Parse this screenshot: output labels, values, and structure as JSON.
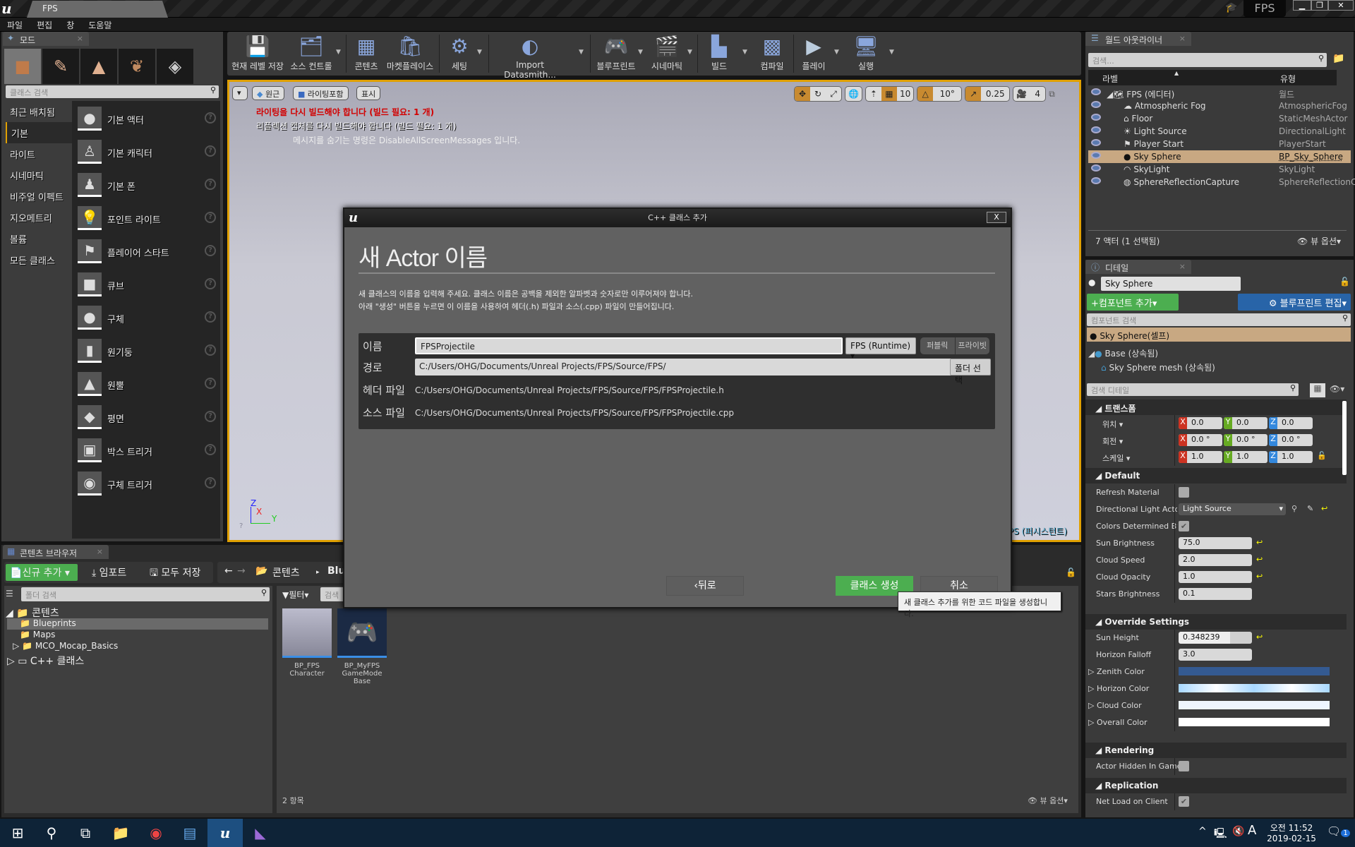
{
  "window": {
    "doc_tab": "FPS",
    "project_label": "FPS",
    "controls": {
      "minimize": "▁",
      "restore": "❐",
      "close": "✕"
    }
  },
  "menu": [
    "파일",
    "편집",
    "창",
    "도움말"
  ],
  "modes_panel": {
    "tab_label": "모드",
    "search_placeholder": "클래스 검색",
    "categories": [
      {
        "label": "최근 배치됨",
        "selected": false
      },
      {
        "label": "기본",
        "selected": true
      },
      {
        "label": "라이트",
        "selected": false
      },
      {
        "label": "시네마틱",
        "selected": false
      },
      {
        "label": "비주얼 이펙트",
        "selected": false
      },
      {
        "label": "지오메트리",
        "selected": false
      },
      {
        "label": "볼륨",
        "selected": false
      },
      {
        "label": "모든 클래스",
        "selected": false
      }
    ],
    "items": [
      {
        "label": "기본 액터",
        "icon": "sphere-icon"
      },
      {
        "label": "기본 캐릭터",
        "icon": "character-icon"
      },
      {
        "label": "기본 폰",
        "icon": "pawn-icon"
      },
      {
        "label": "포인트 라이트",
        "icon": "bulb-icon"
      },
      {
        "label": "플레이어 스타트",
        "icon": "player-start-icon"
      },
      {
        "label": "큐브",
        "icon": "cube-icon"
      },
      {
        "label": "구체",
        "icon": "sphere-icon"
      },
      {
        "label": "원기둥",
        "icon": "cylinder-icon"
      },
      {
        "label": "원뿔",
        "icon": "cone-icon"
      },
      {
        "label": "평면",
        "icon": "plane-icon"
      },
      {
        "label": "박스 트리거",
        "icon": "box-trigger-icon"
      },
      {
        "label": "구체 트리거",
        "icon": "sphere-trigger-icon"
      }
    ]
  },
  "toolbar": {
    "buttons": [
      {
        "label": "현재 레벨 저장",
        "icon": "save-icon"
      },
      {
        "label": "소스 컨트롤",
        "icon": "source-control-icon"
      },
      {
        "label": "콘텐츠",
        "icon": "content-icon"
      },
      {
        "label": "마켓플레이스",
        "icon": "marketplace-icon"
      },
      {
        "label": "세팅",
        "icon": "settings-icon"
      },
      {
        "label": "Import Datasmith...",
        "icon": "datasmith-icon"
      },
      {
        "label": "블루프린트",
        "icon": "blueprint-icon"
      },
      {
        "label": "시네마틱",
        "icon": "cinematic-icon"
      },
      {
        "label": "빌드",
        "icon": "build-icon"
      },
      {
        "label": "컴파일",
        "icon": "compile-icon"
      },
      {
        "label": "플레이",
        "icon": "play-icon"
      },
      {
        "label": "실행",
        "icon": "launch-icon"
      }
    ]
  },
  "viewport": {
    "perspective": "원근",
    "lit": "라이팅포함",
    "show": "표시",
    "messages": {
      "error": "라이팅을 다시 빌드해야 합니다 (빌드 필요: 1 개)",
      "warning": "리플렉션 캡처를 다시 빌드해야 합니다 (빌드 필요: 1 개)",
      "hint": "메시지를 숨기는 명령은 DisableAllScreenMessages 입니다."
    },
    "grid_snap": "10",
    "rotation_snap": "10°",
    "scale_snap": "0.25",
    "camera_speed": "4",
    "level_label": "PS (퍼시스턴트)",
    "axes": {
      "x": "X",
      "y": "Y",
      "z": "Z"
    }
  },
  "dialog": {
    "title": "C++ 클래스 추가",
    "close": "X",
    "heading": "새 Actor 이름",
    "desc1": "새 클래스의 이름을 입력해 주세요. 클래스 이름은 공백을 제외한 알파벳과 숫자로만 이루어져야 합니다.",
    "desc2": "아래 \"생성\" 버튼을 누르면 이 이름을 사용하여 헤더(.h) 파일과 소스(.cpp) 파일이 만들어집니다.",
    "name_label": "이름",
    "name_value": "FPSProjectile",
    "module": "FPS (Runtime)",
    "public": "퍼블릭",
    "private": "프라이빗",
    "path_label": "경로",
    "path_value": "C:/Users/OHG/Documents/Unreal Projects/FPS/Source/FPS/",
    "folder_btn": "폴더 선택",
    "header_label": "헤더 파일",
    "header_value": "C:/Users/OHG/Documents/Unreal Projects/FPS/Source/FPS/FPSProjectile.h",
    "source_label": "소스 파일",
    "source_value": "C:/Users/OHG/Documents/Unreal Projects/FPS/Source/FPS/FPSProjectile.cpp",
    "back": "‹뒤로",
    "create": "클래스 생성",
    "cancel": "취소",
    "tooltip": "새 클래스 추가를 위한 코드 파일을 생성합니다."
  },
  "content_browser": {
    "tab_label": "콘텐츠 브라우저",
    "add_new": "신규 추가",
    "import": "임포트",
    "save_all": "모두 저장",
    "path_root": "콘텐츠",
    "path_current": "Blu",
    "folder_search_placeholder": "폴더 검색",
    "filter": "필터",
    "asset_search_placeholder": "검색",
    "tree": [
      {
        "label": "콘텐츠",
        "level": 0,
        "expanded": true
      },
      {
        "label": "Blueprints",
        "level": 1,
        "selected": true
      },
      {
        "label": "Maps",
        "level": 1
      },
      {
        "label": "MCO_Mocap_Basics",
        "level": 1,
        "collapsed": true
      },
      {
        "label": "C++ 클래스",
        "level": 0,
        "collapsed": true
      }
    ],
    "assets": [
      {
        "label": "BP_FPS Character"
      },
      {
        "label": "BP_MyFPS GameMode Base"
      }
    ],
    "item_count": "2 항목",
    "view_options": "뷰 옵션"
  },
  "outliner": {
    "tab_label": "월드 아웃라이너",
    "search_placeholder": "검색...",
    "col_label": "라벨",
    "col_type": "유형",
    "rows": [
      {
        "label": "FPS (에디터)",
        "type": "월드",
        "indent": 0
      },
      {
        "label": "Atmospheric Fog",
        "type": "AtmosphericFog",
        "indent": 1
      },
      {
        "label": "Floor",
        "type": "StaticMeshActor",
        "indent": 1
      },
      {
        "label": "Light Source",
        "type": "DirectionalLight",
        "indent": 1
      },
      {
        "label": "Player Start",
        "type": "PlayerStart",
        "indent": 1
      },
      {
        "label": "Sky Sphere",
        "type": "BP_Sky_Sphere",
        "indent": 1,
        "selected": true
      },
      {
        "label": "SkyLight",
        "type": "SkyLight",
        "indent": 1
      },
      {
        "label": "SphereReflectionCapture",
        "type": "SphereReflectionC",
        "indent": 1
      }
    ],
    "footer": "7 액터 (1 선택됨)",
    "view_options": "뷰 옵션"
  },
  "details": {
    "tab_label": "디테일",
    "actor_name": "Sky Sphere",
    "add_component": "컴포넌트 추가",
    "edit_blueprint": "블루프린트 편집",
    "component_search_placeholder": "컴포넌트 검색",
    "self_component": "Sky Sphere(셀프)",
    "components": [
      "Base (상속됨)",
      "Sky Sphere mesh (상속됨)"
    ],
    "details_search_placeholder": "검색 디테일",
    "transform": {
      "header": "트랜스폼",
      "location": {
        "label": "위치",
        "x": "0.0",
        "y": "0.0",
        "z": "0.0"
      },
      "rotation": {
        "label": "회전",
        "x": "0.0 °",
        "y": "0.0 °",
        "z": "0.0 °"
      },
      "scale": {
        "label": "스케일",
        "x": "1.0",
        "y": "1.0",
        "z": "1.0"
      }
    },
    "default": {
      "header": "Default",
      "refresh_material": {
        "label": "Refresh Material",
        "checked": false
      },
      "directional_light_actor": {
        "label": "Directional Light Actor",
        "value": "Light Source"
      },
      "colors_determined_by": {
        "label": "Colors Determined By",
        "checked": true
      },
      "sun_brightness": {
        "label": "Sun Brightness",
        "value": "75.0"
      },
      "cloud_speed": {
        "label": "Cloud Speed",
        "value": "2.0"
      },
      "cloud_opacity": {
        "label": "Cloud Opacity",
        "value": "1.0"
      },
      "stars_brightness": {
        "label": "Stars Brightness",
        "value": "0.1"
      }
    },
    "override": {
      "header": "Override Settings",
      "sun_height": {
        "label": "Sun Height",
        "value": "0.348239"
      },
      "horizon_falloff": {
        "label": "Horizon Falloff",
        "value": "3.0"
      },
      "zenith_color": {
        "label": "Zenith Color",
        "color": "#345a91"
      },
      "horizon_color": {
        "label": "Horizon Color",
        "color": "#bfe3ff"
      },
      "cloud_color": {
        "label": "Cloud Color",
        "color": "#eef5ff"
      },
      "overall_color": {
        "label": "Overall Color",
        "color": "#ffffff"
      }
    },
    "rendering": {
      "header": "Rendering",
      "actor_hidden": {
        "label": "Actor Hidden In Game",
        "checked": false
      }
    },
    "replication": {
      "header": "Replication",
      "net_load": {
        "label": "Net Load on Client",
        "checked": true
      }
    }
  },
  "taskbar": {
    "time": "오전 11:52",
    "date": "2019-02-15",
    "ime": "A",
    "notifications": "1"
  }
}
